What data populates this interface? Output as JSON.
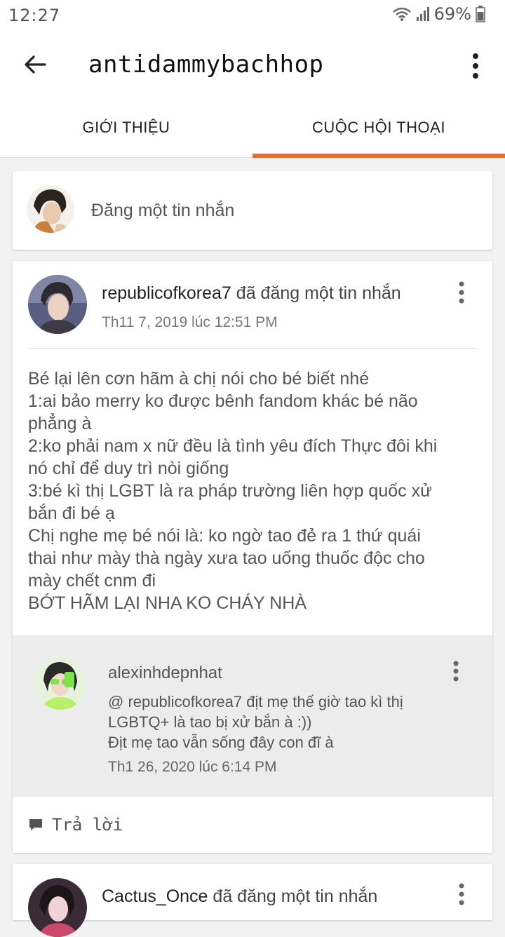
{
  "status": {
    "time": "12:27",
    "battery": "69%"
  },
  "appbar": {
    "title": "antidammybachhop"
  },
  "tabs": [
    {
      "label": "GIỚI THIỆU"
    },
    {
      "label": "CUỘC HỘI THOẠI"
    }
  ],
  "composer": {
    "placeholder": "Đăng một tin nhắn"
  },
  "post": {
    "username": "republicofkorea7",
    "action": "đã đăng một tin nhắn",
    "date": "Th11 7, 2019 lúc 12:51 PM",
    "body_lines": [
      "Bé lại lên cơn hãm à chị nói cho bé biết nhé",
      "1:ai bảo merry ko được bênh fandom khác bé não",
      "phẳng à",
      "2:ko phải nam x nữ đều là tình yêu đích Thực đôi khi",
      "nó chỉ để duy trì nòi giống",
      "3:bé kì thị LGBT là ra pháp trường liên hợp quốc xử",
      "bắn đi bé ạ",
      "Chị nghe mẹ bé nói là: ko ngờ tao đẻ ra 1 thứ quái",
      "thai như mày thà ngày xưa tao uống thuốc độc cho",
      "mày chết cnm đi",
      "BỚT HÃM LẠI NHA KO CHÁY NHÀ"
    ],
    "reply": {
      "username": "alexinhdepnhat",
      "lines": [
        "@ republicofkorea7   địt mẹ thế giờ tao kì thị",
        "LGBTQ+ là tao bị xử bắn à :))",
        "Địt mẹ tao vẫn sống đây con đĩ à"
      ],
      "date": "Th1 26, 2020 lúc 6:14 PM"
    },
    "reply_button": "Trả lời"
  },
  "post2": {
    "username": "Cactus_Once",
    "action": "đã đăng một tin nhắn"
  }
}
